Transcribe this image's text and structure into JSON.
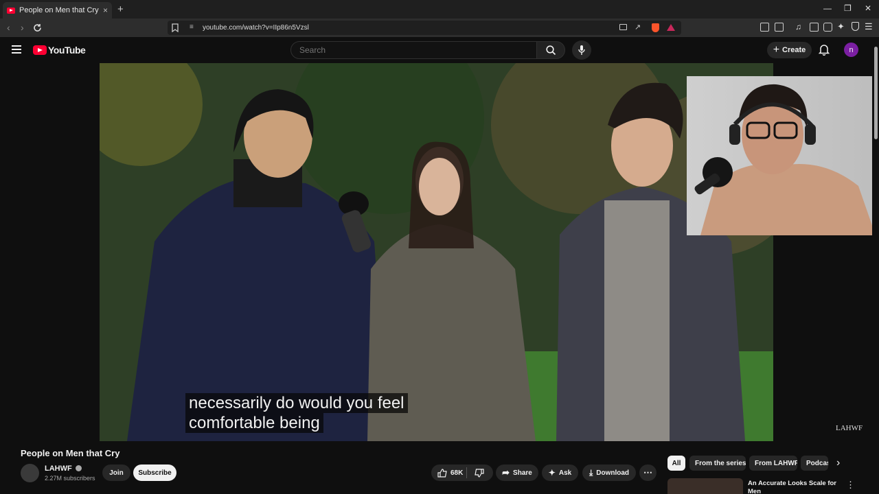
{
  "browser": {
    "tab_title": "People on Men that Cry - YouTube",
    "url": "youtube.com/watch?v=IIp86n5Vzsl",
    "new_tab_symbol": "+",
    "tab_close_symbol": "×"
  },
  "masthead": {
    "logo_text": "YouTube",
    "search_placeholder": "Search",
    "create_label": "Create",
    "avatar_letter": "n"
  },
  "video": {
    "caption_line1": "necessarily do would you feel",
    "caption_line2": "comfortable being",
    "watermark": "LAHWF"
  },
  "watch": {
    "title": "People on Men that Cry",
    "channel_name": "LAHWF",
    "subscribers": "2.27M subscribers",
    "join_label": "Join",
    "subscribe_label": "Subscribe",
    "like_count": "68K",
    "share_label": "Share",
    "ask_label": "Ask",
    "download_label": "Download"
  },
  "sidebar": {
    "chips": [
      "All",
      "From the series",
      "From LAHWF",
      "Podcasts"
    ],
    "rec_title": "An Accurate Looks Scale for Men"
  },
  "colors": {
    "accent": "#ff0033",
    "avatar": "#7b1fa2",
    "background": "#0f0f0f"
  }
}
